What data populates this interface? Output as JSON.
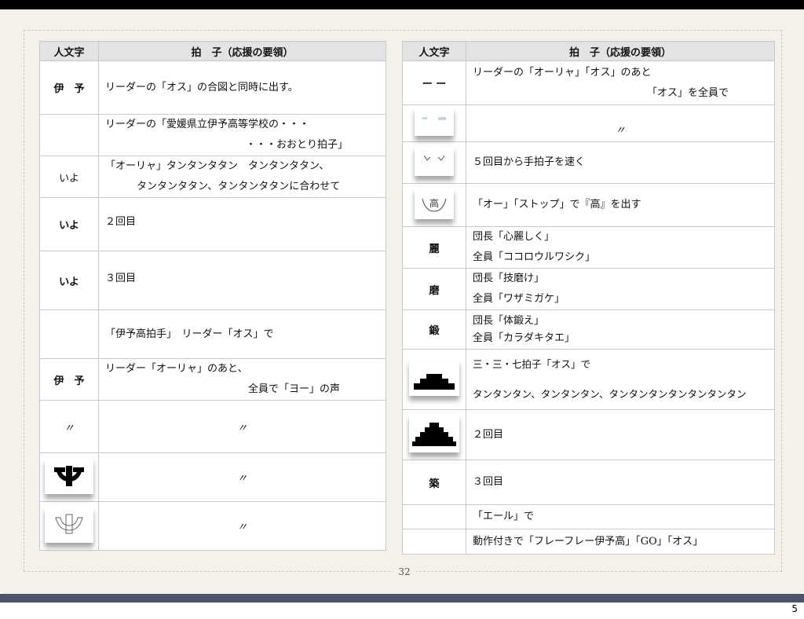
{
  "header": {
    "col1": "人文字",
    "col2": "拍　子（応援の要領）"
  },
  "left_rows": [
    {
      "symbol": "伊　予",
      "lines": [
        "リーダーの「オス」の合図と同時に出す。"
      ]
    },
    {
      "symbol": "",
      "lines": [
        "リーダーの「愛媛県立伊予高等学校の・・・",
        "・・・おおとり拍子」"
      ]
    },
    {
      "symbol": "いよ",
      "lines": [
        "「オーリャ」タンタンタタン　タンタンタタン、",
        "タンタンタタン、タンタンタタンに合わせて"
      ]
    },
    {
      "symbol": "いよ",
      "lines": [
        "２回目"
      ]
    },
    {
      "symbol": "いよ",
      "lines": [
        "３回目"
      ]
    },
    {
      "symbol": "",
      "lines": [
        "「伊予高拍手」　リーダー「オス」で"
      ]
    },
    {
      "symbol": "伊　予",
      "lines": [
        "リーダー「オーリャ」のあと、",
        "全員で「ヨー」の声"
      ]
    },
    {
      "symbol": "〃",
      "lines": [
        "〃"
      ]
    },
    {
      "symbol": "crest-bold-icon",
      "lines": [
        "〃"
      ]
    },
    {
      "symbol": "crest-outline-icon",
      "lines": [
        "〃"
      ]
    }
  ],
  "right_rows": [
    {
      "symbol": "ー ー",
      "lines": [
        "リーダーの「オーリャ」「オス」のあと",
        "「オス」を全員で"
      ]
    },
    {
      "symbol": "blank-card-icon",
      "lines": [
        "〃"
      ]
    },
    {
      "symbol": "bracket-marks-icon",
      "lines": [
        "５回目から手拍子を速く"
      ]
    },
    {
      "symbol": "taka-crest-icon",
      "lines": [
        "「オー」「ストップ」で『高』を出す"
      ]
    },
    {
      "symbol": "麗",
      "lines": [
        "団長「心麗しく」",
        "全員「ココロウルワシク」"
      ]
    },
    {
      "symbol": "磨",
      "lines": [
        "団長「技磨け」",
        "全員「ワザミガケ」"
      ]
    },
    {
      "symbol": "鍛",
      "lines": [
        "団長「体鍛え」",
        "全員「カラダキタエ」"
      ]
    },
    {
      "symbol": "stair-small-icon",
      "lines": [
        "三・三・七拍子「オス」で",
        "タンタンタン、タンタンタン、タンタンタンタンタンタンタン"
      ]
    },
    {
      "symbol": "stair-large-icon",
      "lines": [
        "２回目"
      ]
    },
    {
      "symbol": "築",
      "lines": [
        "３回目"
      ]
    },
    {
      "symbol": "",
      "lines": [
        "「エール」で"
      ]
    },
    {
      "symbol": "",
      "lines": [
        "動作付きで「フレーフレー伊予高」「GO」「オス」"
      ]
    }
  ],
  "footer": {
    "page_number": "32",
    "slide_number": "5"
  }
}
